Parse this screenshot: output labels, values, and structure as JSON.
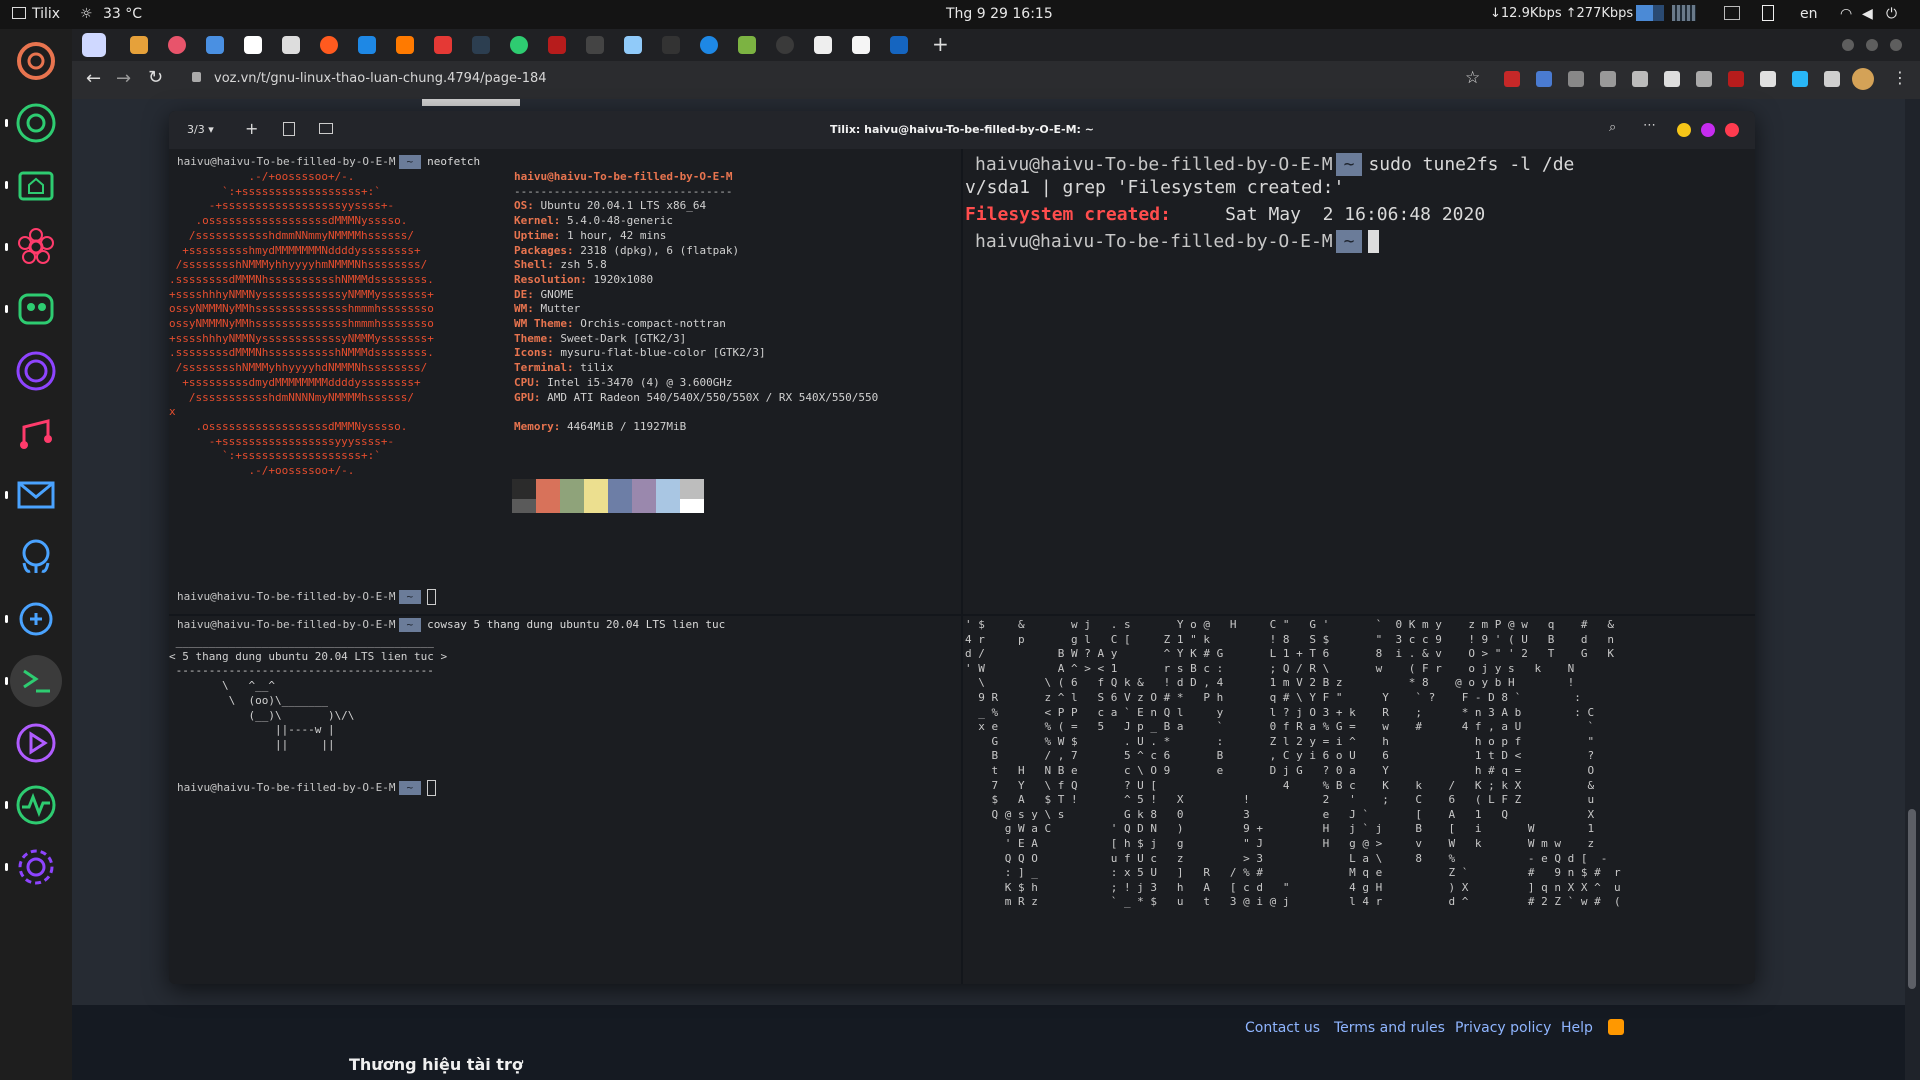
{
  "topbar": {
    "app_name": "Tilix",
    "weather": "33 °C",
    "clock": "Thg 9 29  16:15",
    "network_down": "↓12.9Kbps",
    "network_up": "↑277Kbps",
    "language": "en"
  },
  "browser": {
    "url": "voz.vn/t/gnu-linux-thao-luan-chung.4794/page-184",
    "footer_links": [
      "Contact us",
      "Terms and rules",
      "Privacy policy",
      "Help"
    ],
    "sponsor": "Thương hiệu tài trợ"
  },
  "tilix": {
    "session_count": "3/3",
    "title": "Tilix: haivu@haivu-To-be-filled-by-O-E-M: ~",
    "prompt_user": "haivu@haivu-To-be-filled-by-O-E-M",
    "prompt_dir": "~",
    "pane1": {
      "command": "neofetch",
      "logo": [
        "            .-/+oossssoo+/-.",
        "        `:+ssssssssssssssssss+:`",
        "      -+ssssssssssssssssssyyssss+-",
        "    .ossssssssssssssssssdMMMNysssso.",
        "   /ssssssssssshdmmNNmmyNMMMMhssssss/",
        "  +ssssssssshmydMMMMMMMNddddyssssssss+",
        " /sssssssshNMMMyhhyyyyhmNMMMNhssssssss/",
        ".ssssssssdMMMNhsssssssssshNMMMdssssssss.",
        "+sssshhhyNMMNyssssssssssssyNMMMysssssss+",
        "ossyNMMMNyMMhsssssssssssssshmmmhssssssso",
        "ossyNMMMNyMMhsssssssssssssshmmmhssssssso",
        "+sssshhhyNMMNyssssssssssssyNMMMysssssss+",
        ".ssssssssdMMMNhsssssssssshNMMMdssssssss.",
        " /sssssssshNMMMyhhyyyyhdNMMMNhssssssss/",
        "  +sssssssssdmydMMMMMMMMddddyssssssss+",
        "   /ssssssssssshdmNNNNmyNMMMMhssssss/",
        "x",
        "    .ossssssssssssssssssdMMMNysssso.",
        "      -+sssssssssssssssssyyyssss+-",
        "        `:+ssssssssssssssssss+:`",
        "            .-/+oossssoo+/-."
      ],
      "info_header": "haivu@haivu-To-be-filled-by-O-E-M",
      "info_rule": "---------------------------------",
      "info": [
        {
          "k": "OS",
          "v": "Ubuntu 20.04.1 LTS x86_64"
        },
        {
          "k": "Kernel",
          "v": "5.4.0-48-generic"
        },
        {
          "k": "Uptime",
          "v": "1 hour, 42 mins"
        },
        {
          "k": "Packages",
          "v": "2318 (dpkg), 6 (flatpak)"
        },
        {
          "k": "Shell",
          "v": "zsh 5.8"
        },
        {
          "k": "Resolution",
          "v": "1920x1080"
        },
        {
          "k": "DE",
          "v": "GNOME"
        },
        {
          "k": "WM",
          "v": "Mutter"
        },
        {
          "k": "WM Theme",
          "v": "Orchis-compact-nottran"
        },
        {
          "k": "Theme",
          "v": "Sweet-Dark [GTK2/3]"
        },
        {
          "k": "Icons",
          "v": "mysuru-flat-blue-color [GTK2/3]"
        },
        {
          "k": "Terminal",
          "v": "tilix"
        },
        {
          "k": "CPU",
          "v": "Intel i5-3470 (4) @ 3.600GHz"
        },
        {
          "k": "GPU",
          "v": "AMD ATI Radeon 540/540X/550/550X / RX 540X/550/550"
        },
        {
          "k": "Memory",
          "v": "4464MiB / 11927MiB"
        }
      ],
      "palette_top": [
        "#2b2b2b",
        "#d8725a",
        "#8fa37a",
        "#ecdf8f",
        "#6d7ea6",
        "#9a88ad",
        "#a9c6e3",
        "#bdbdbd"
      ],
      "palette_bottom": [
        "#5a5a5a",
        "#d8725a",
        "#8fa37a",
        "#ecdf8f",
        "#6d7ea6",
        "#9a88ad",
        "#a9c6e3",
        "#ffffff"
      ]
    },
    "pane2": {
      "command_1": "sudo tune2fs -l /de",
      "command_2": "v/sda1 | grep 'Filesystem created:'",
      "output_key": "Filesystem created:",
      "output_value": "     Sat May  2 16:06:48 2020"
    },
    "pane3": {
      "command": "cowsay 5 thang dung ubuntu 20.04 LTS lien tuc",
      "cowsay": [
        " _______________________________________",
        "< 5 thang dung ubuntu 20.04 LTS lien tuc >",
        " ---------------------------------------",
        "        \\   ^__^",
        "         \\  (oo)\\_______",
        "            (__)\\       )\\/\\",
        "                ||----w |",
        "                ||     ||"
      ]
    },
    "pane4": {
      "rain": [
        "' $     &       w j   . s       Y o @   H     C \"   G '       `  0 K m y    z m P @ w   q    #   &",
        "4 r     p       g l   C [     Z 1 \" k         ! 8   S $       \"  3 c c 9    ! 9 ' ( U   B    d   n",
        "d /           B W ? A y       ^ Y K # G       L 1 + T 6       8  i . & v    O > \" ' 2   T    G   K",
        "' W           A ^ > < 1       r s B c :       ; Q / R \\       w    ( F r    o j y s   k    N",
        "  \\         \\ ( 6   f Q k &   ! d D , 4       1 m V 2 B z          * 8    @ o y b H        !",
        "  9 R       z ^ l   S 6 V z O # *   P h       q # \\ Y F \"      Y    ` ?    F - D 8 `        :",
        "  _ %       < P P   c a ` E n Q l     y       l ? j O 3 + k    R    ;      * n 3 A b        : C",
        "  x e       % ( =   5   J p _ B a     `       0 f R a % G =    w    #      4 f , a U          `",
        "    G       % W $       . U . *       :       Z l 2 y = i ^    h             h o p f          \"",
        "    B       / , 7       5 ^ c 6       B       , C y i 6 o U    6             1 t D <          ?",
        "    t   H   N B e       c \\ O 9       e       D j G   ? 0 a    Y             h # q =          O",
        "    7   Y   \\ f Q       ? U [                   4     % B c    K    k    /   K ; k X          &",
        "    $   A   $ T !       ^ 5 !   X         !           2   '    ;    C    6   ( L F Z          u",
        "    Q @ s y \\ s         G k 8   0         3           e   J `       [    A   1   Q            X",
        "      g W a C         ' Q D N   )         9 +         H   j ` j     B    [   i       W        1",
        "      ' E A           [ h $ j   g         \" J         H   g @ >     v    W   k       W m w    z",
        "      Q Q O           u f U c   z         > 3             L a \\     8    %           - e Q d [  -",
        "      : ] _           : x 5 U   ]   R   / % #             M q e          Z `         #   9 n $ #  r",
        "      K $ h           ; ! j 3   h   A   [ c d   \"         4 g H          ) X         ] q n X X ^  u",
        "      m R z           ` _ * $   u   t   3 @ i @ j         l 4 r          d ^         # 2 Z ` w #  ("
      ]
    }
  },
  "colors": {
    "accent": "#6b7c99",
    "ubuntu": "#e54d2e",
    "term_fg": "#cfcfcf",
    "info_key": "#e8744f"
  }
}
